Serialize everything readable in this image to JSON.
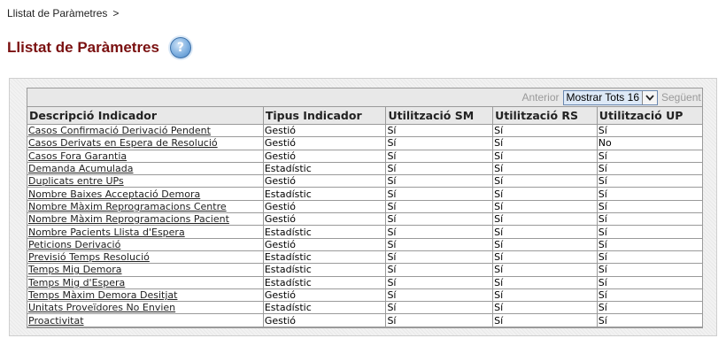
{
  "breadcrumb": {
    "item": "Llistat de Paràmetres",
    "separator": ">"
  },
  "page": {
    "title": "Llistat de Paràmetres",
    "help_icon": "help-circle-icon",
    "help_glyph": "?"
  },
  "pager": {
    "prev_label": "Anterior",
    "select_value": "Mostrar Tots 16",
    "next_label": "Següent"
  },
  "table": {
    "columns": [
      "Descripció Indicador",
      "Tipus Indicador",
      "Utilització SM",
      "Utilització RS",
      "Utilització UP"
    ],
    "rows": [
      [
        "Casos Confirmació Derivació Pendent",
        "Gestió",
        "Sí",
        "Sí",
        "Sí"
      ],
      [
        "Casos Derivats en Espera de Resolució",
        "Gestió",
        "Sí",
        "Sí",
        "No"
      ],
      [
        "Casos Fora Garantia",
        "Gestió",
        "Sí",
        "Sí",
        "Sí"
      ],
      [
        "Demanda Acumulada",
        "Estadístic",
        "Sí",
        "Sí",
        "Sí"
      ],
      [
        "Duplicats entre UPs",
        "Gestió",
        "Sí",
        "Sí",
        "Sí"
      ],
      [
        "Nombre Baixes Acceptació Demora",
        "Estadístic",
        "Sí",
        "Sí",
        "Sí"
      ],
      [
        "Nombre Màxim Reprogramacions Centre",
        "Gestió",
        "Sí",
        "Sí",
        "Sí"
      ],
      [
        "Nombre Màxim Reprogramacions Pacient",
        "Gestió",
        "Sí",
        "Sí",
        "Sí"
      ],
      [
        "Nombre Pacients Llista d'Espera",
        "Estadístic",
        "Sí",
        "Sí",
        "Sí"
      ],
      [
        "Peticions Derivació",
        "Gestió",
        "Sí",
        "Sí",
        "Sí"
      ],
      [
        "Previsió Temps Resolució",
        "Estadístic",
        "Sí",
        "Sí",
        "Sí"
      ],
      [
        "Temps Mig Demora",
        "Estadístic",
        "Sí",
        "Sí",
        "Sí"
      ],
      [
        "Temps Mig d'Espera",
        "Estadístic",
        "Sí",
        "Sí",
        "Sí"
      ],
      [
        "Temps Màxim Demora Desitjat",
        "Gestió",
        "Sí",
        "Sí",
        "Sí"
      ],
      [
        "Unitats Proveïdores No Envien",
        "Estadístic",
        "Sí",
        "Sí",
        "Sí"
      ],
      [
        "Proactivitat",
        "Gestió",
        "Sí",
        "Sí",
        "Sí"
      ]
    ]
  }
}
